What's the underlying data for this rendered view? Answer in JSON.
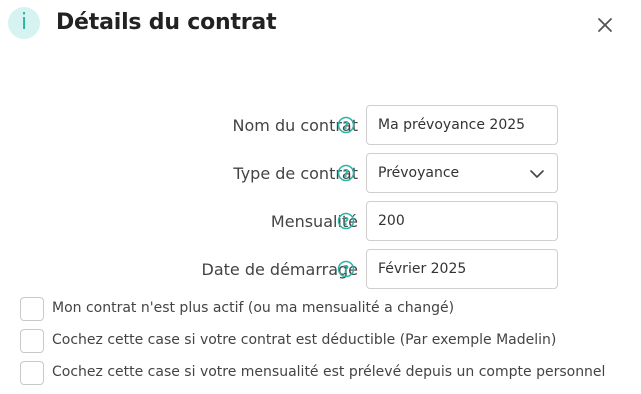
{
  "dialog": {
    "title": "Détails du contrat",
    "info_icon_glyph": "i",
    "accent_color": "#2bb5a8"
  },
  "form": {
    "contract_name": {
      "label": "Nom du contrat",
      "value": "Ma prévoyance 2025"
    },
    "contract_type": {
      "label": "Type de contrat",
      "value": "Prévoyance"
    },
    "monthly_amount": {
      "label": "Mensualité",
      "value": "200"
    },
    "start_date": {
      "label": "Date de démarrage",
      "value": "Février 2025"
    }
  },
  "checkboxes": [
    {
      "label": "Mon contrat n'est plus actif (ou ma mensualité a changé)",
      "checked": false
    },
    {
      "label": "Cochez cette case si votre contrat est déductible (Par exemple Madelin)",
      "checked": false
    },
    {
      "label": "Cochez cette case si votre mensualité est prélevé depuis un compte personnel",
      "checked": false
    }
  ],
  "icons": {
    "info": "info-icon",
    "close": "close-icon",
    "help": "help-circle-icon",
    "dropdown": "chevron-down-icon"
  }
}
